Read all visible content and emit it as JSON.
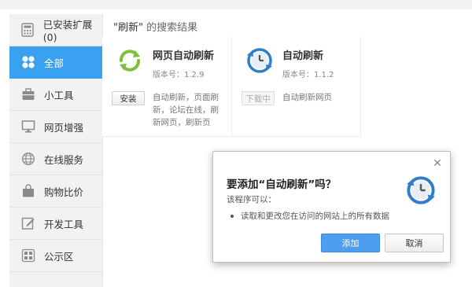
{
  "sidebar": {
    "items": [
      {
        "label": "已安装扩展(0)",
        "icon": "calculator-icon",
        "active": false
      },
      {
        "label": "全部",
        "icon": "grid-clover-icon",
        "active": true
      },
      {
        "label": "小工具",
        "icon": "toolbox-icon",
        "active": false
      },
      {
        "label": "网页增强",
        "icon": "monitor-icon",
        "active": false
      },
      {
        "label": "在线服务",
        "icon": "globe-icon",
        "active": false
      },
      {
        "label": "购物比价",
        "icon": "shopping-bag-icon",
        "active": false
      },
      {
        "label": "开发工具",
        "icon": "edit-icon",
        "active": false
      },
      {
        "label": "公示区",
        "icon": "apps-grid-icon",
        "active": false
      }
    ]
  },
  "search": {
    "keyword": "\"刷新\"",
    "suffix": " 的搜索结果"
  },
  "results": [
    {
      "name": "网页自动刷新",
      "version": "版本号：1.2.9",
      "button": "安装",
      "button_disabled": false,
      "description": "自动刷新，页面刷新，论坛在线，刷新网页，刷新页",
      "icon": "refresh-arrows-icon"
    },
    {
      "name": "自动刷新",
      "version": "版本号：1.1.2",
      "button": "下载中",
      "button_disabled": true,
      "description": "自动刷新网页",
      "icon": "clock-refresh-icon"
    }
  ],
  "dialog": {
    "title": "要添加“自动刷新”吗？",
    "subtitle": "该程序可以：",
    "permission": "读取和更改您在访问的网站上的所有数据",
    "add_label": "添加",
    "cancel_label": "取消",
    "close_symbol": "✕",
    "icon": "clock-refresh-icon"
  },
  "colors": {
    "accent": "#39a1f0",
    "add_button": "#4d9df0"
  }
}
